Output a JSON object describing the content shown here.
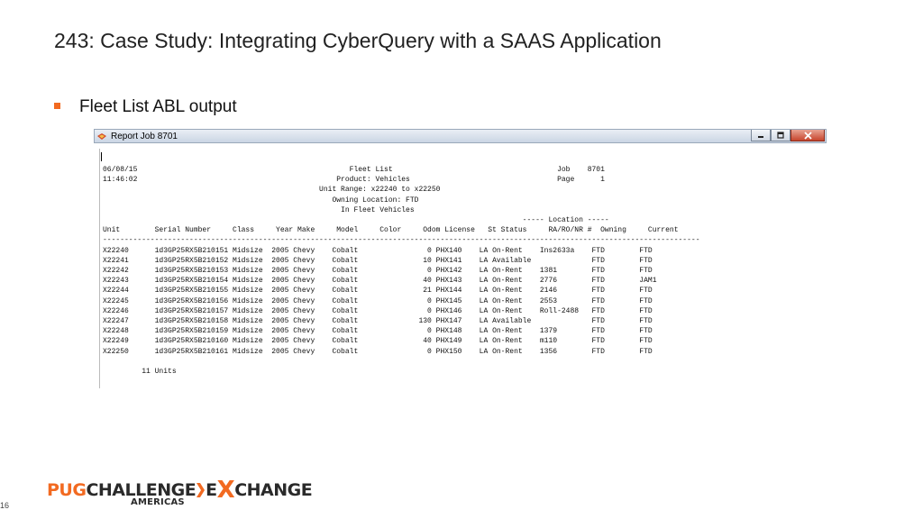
{
  "slide": {
    "title": "243: Case Study: Integrating CyberQuery with a SAAS Application",
    "bullet": "Fleet List ABL output",
    "page_number": "16",
    "bullet_color": "#f26a21"
  },
  "window": {
    "title": "Report Job 8701",
    "icon": "report-app-icon",
    "controls": [
      "minimize-icon",
      "maximize-icon",
      "close-icon"
    ]
  },
  "report": {
    "header_lines": [
      "06/08/15                                                 Fleet List                                      Job    8701",
      "11:46:02                                              Product: Vehicles                                  Page      1",
      "                                                  Unit Range: x22240 to x22250",
      "                                                     Owning Location: FTD",
      "                                                       In Fleet Vehicles",
      "                                                                                                 ----- Location -----",
      "Unit        Serial Number     Class     Year Make     Model     Color     Odom License   St Status     RA/RO/NR #  Owning     Current",
      "------------------------------------------------------------------------------------------------------------------------------------------"
    ],
    "rows": [
      "X22240      1d3GP25RX5B210151 Midsize  2005 Chevy    Cobalt                0 PHX140    LA On-Rent    Ins2633a    FTD        FTD",
      "X22241      1d3GP25RX5B210152 Midsize  2005 Chevy    Cobalt               10 PHX141    LA Available              FTD        FTD",
      "X22242      1d3GP25RX5B210153 Midsize  2005 Chevy    Cobalt                0 PHX142    LA On-Rent    1381        FTD        FTD",
      "X22243      1d3GP25RX5B210154 Midsize  2005 Chevy    Cobalt               40 PHX143    LA On-Rent    2776        FTD        JAM1",
      "X22244      1d3GP25RX5B210155 Midsize  2005 Chevy    Cobalt               21 PHX144    LA On-Rent    2146        FTD        FTD",
      "X22245      1d3GP25RX5B210156 Midsize  2005 Chevy    Cobalt                0 PHX145    LA On-Rent    2553        FTD        FTD",
      "X22246      1d3GP25RX5B210157 Midsize  2005 Chevy    Cobalt                0 PHX146    LA On-Rent    Roll-2488   FTD        FTD",
      "X22247      1d3GP25RX5B210158 Midsize  2005 Chevy    Cobalt              130 PHX147    LA Available              FTD        FTD",
      "X22248      1d3GP25RX5B210159 Midsize  2005 Chevy    Cobalt                0 PHX148    LA On-Rent    1379        FTD        FTD",
      "X22249      1d3GP25RX5B210160 Midsize  2005 Chevy    Cobalt               40 PHX149    LA On-Rent    m110        FTD        FTD",
      "X22250      1d3GP25RX5B210161 Midsize  2005 Chevy    Cobalt                0 PHX150    LA On-Rent    1356        FTD        FTD"
    ],
    "footer": "         11 Units"
  },
  "logo": {
    "part1": "PUG",
    "part2": "CHALLENGE",
    "part3": "E",
    "part4": "X",
    "part5": "CHANGE",
    "subtitle": "AMERICAS",
    "accent_color": "#f26a21",
    "dark_color": "#2a2a2a"
  }
}
